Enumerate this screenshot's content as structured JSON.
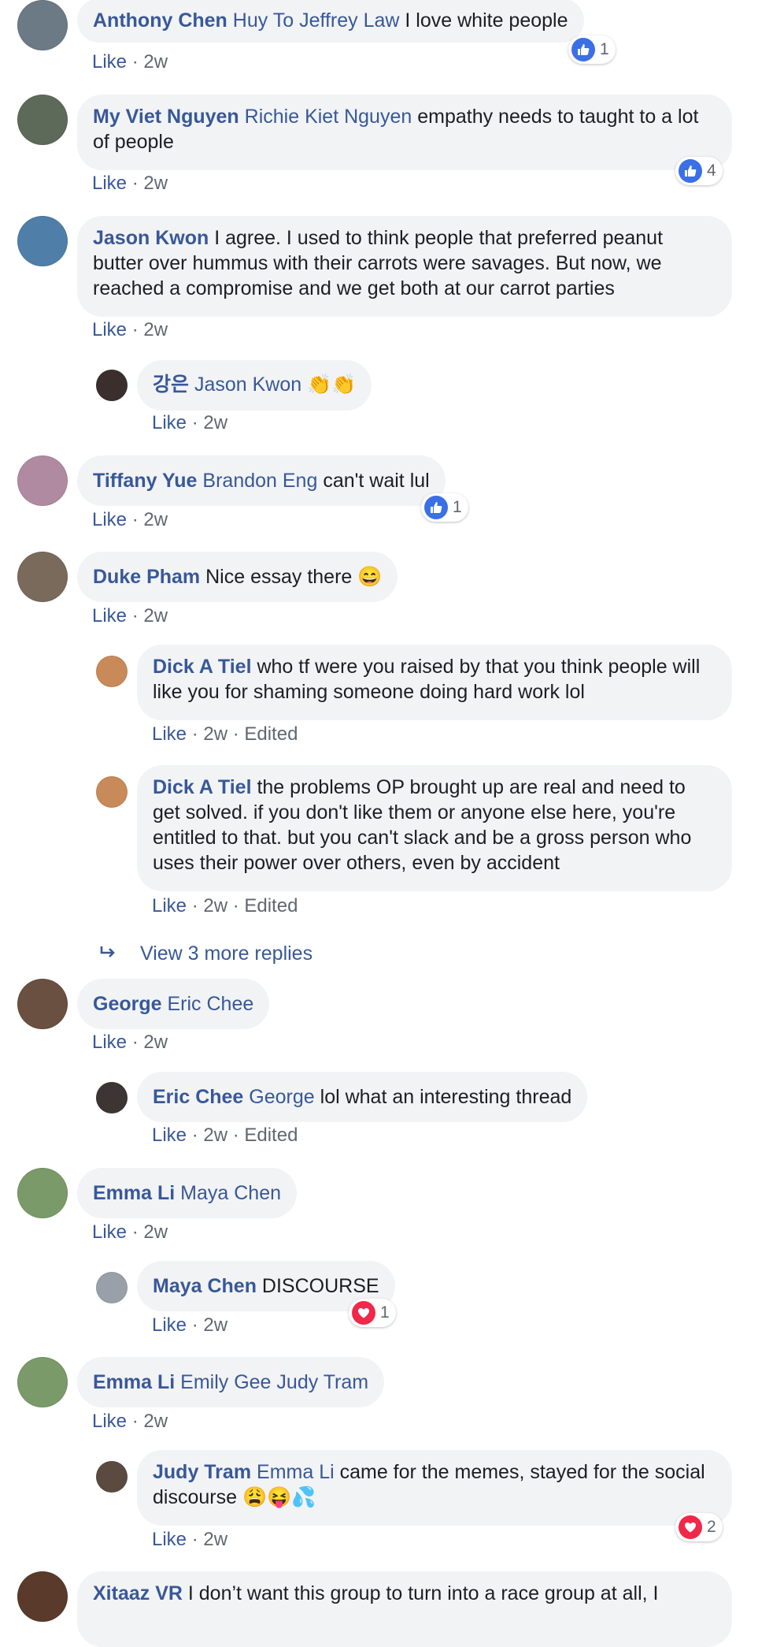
{
  "colors": {
    "link": "#385898",
    "bubble": "#f2f3f5",
    "like_blue": "#3b6fe6",
    "love_red": "#f0284a",
    "meta_gray": "#606770"
  },
  "comments": [
    {
      "author": "Anthony Chen",
      "tags": "Huy To Jeffrey Law",
      "text": " I love white people",
      "like": "Like",
      "time": " · 2w",
      "reaction_count": "1",
      "reaction_icon": "thumbs-up-icon"
    },
    {
      "author": "My Viet Nguyen",
      "tags": "Richie Kiet Nguyen",
      "text": " empathy needs to taught to a lot of people",
      "like": "Like",
      "time": " · 2w",
      "reaction_count": "4",
      "reaction_icon": "thumbs-up-icon"
    },
    {
      "author": "Jason Kwon",
      "text": " I agree. I used to think people that preferred peanut butter over hummus with their carrots were savages. But now, we reached a compromise and we get both at our carrot parties",
      "like": "Like",
      "time": " · 2w"
    },
    {
      "author": "강은",
      "tags": "Jason Kwon",
      "text": " 👏👏",
      "like": "Like",
      "time": " · 2w"
    },
    {
      "author": "Tiffany Yue",
      "tags": "Brandon Eng",
      "text": " can't wait lul",
      "like": "Like",
      "time": " · 2w",
      "reaction_count": "1",
      "reaction_icon": "thumbs-up-icon"
    },
    {
      "author": "Duke Pham",
      "text": " Nice essay there 😄",
      "like": "Like",
      "time": " · 2w"
    },
    {
      "author": "Dick A Tiel",
      "text": " who tf were you raised by that you think people will like you for shaming someone doing hard work lol",
      "like": "Like",
      "time": " · 2w · Edited"
    },
    {
      "author": "Dick A Tiel",
      "text": " the problems OP brought up are real and need to get solved. if you don't like them or anyone else here, you're entitled to that. but you can't slack and be a gross person who uses their power over others, even by accident",
      "like": "Like",
      "time": " · 2w · Edited"
    },
    {
      "author": "George",
      "tags": "Eric Chee",
      "like": "Like",
      "time": " · 2w"
    },
    {
      "author": "Eric Chee",
      "tags": "George",
      "text": " lol what an interesting thread",
      "like": "Like",
      "time": " · 2w · Edited"
    },
    {
      "author": "Emma Li",
      "tags": "Maya Chen",
      "like": "Like",
      "time": " · 2w"
    },
    {
      "author": "Maya Chen",
      "text": " DISCOURSE",
      "like": "Like",
      "time": " · 2w",
      "reaction_count": "1",
      "reaction_icon": "heart-icon"
    },
    {
      "author": "Emma Li",
      "tags": "Emily Gee Judy Tram",
      "like": "Like",
      "time": " · 2w"
    },
    {
      "author": "Judy Tram",
      "tags": "Emma Li",
      "text": " came for the memes, stayed for the social discourse 😩😝💦",
      "like": "Like",
      "time": " · 2w",
      "reaction_count": "2",
      "reaction_icon": "heart-icon"
    },
    {
      "author": "Xitaaz VR",
      "text": " I don’t want this group to turn into a race group at all, I"
    }
  ],
  "view_more": "View 3 more replies"
}
